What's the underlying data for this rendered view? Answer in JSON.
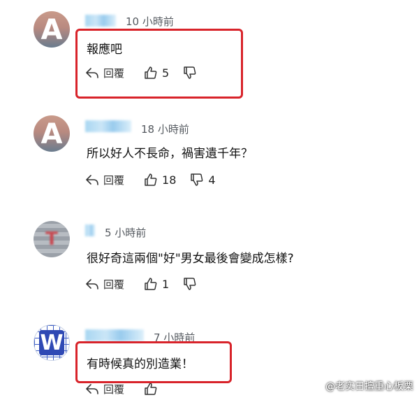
{
  "comments": [
    {
      "avatar_letter": "A",
      "time": "10 小時前",
      "text": "報應吧",
      "reply_label": "回覆",
      "likes": "5",
      "dislikes": ""
    },
    {
      "avatar_letter": "A",
      "time": "18 小時前",
      "text": "所以好人不長命，禍害遺千年？",
      "reply_label": "回覆",
      "likes": "18",
      "dislikes": "4"
    },
    {
      "avatar_letter": "T",
      "time": "5 小時前",
      "text": "很好奇這兩個\"好\"男女最後會變成怎樣?",
      "reply_label": "回覆",
      "likes": "1",
      "dislikes": ""
    },
    {
      "avatar_letter": "W",
      "time": "7 小時前",
      "text": "有時候真的別造業！",
      "reply_label": "回覆",
      "likes": "",
      "dislikes": ""
    }
  ],
  "watermark": "@老实日擅重心板栗",
  "colors": {
    "highlight_box": "#d8232a",
    "text": "#111111",
    "muted": "#555a60"
  }
}
